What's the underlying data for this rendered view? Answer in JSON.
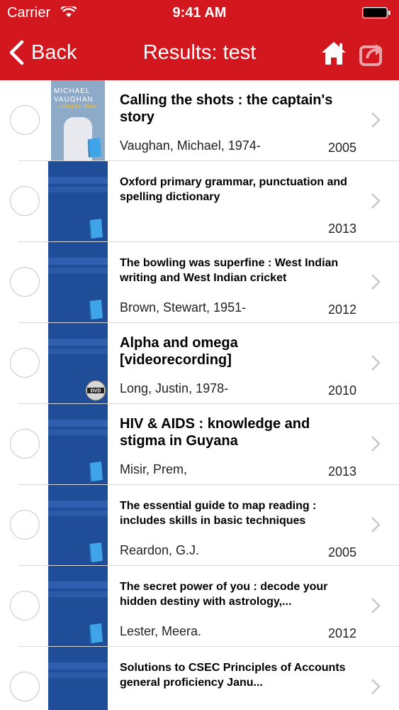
{
  "status_bar": {
    "carrier": "Carrier",
    "time": "9:41 AM"
  },
  "nav": {
    "back_label": "Back",
    "title": "Results: test"
  },
  "results": [
    {
      "title": "Calling the shots : the captain's story",
      "author": "Vaughan, Michael, 1974-",
      "year": "2005",
      "media": "book",
      "cover": {
        "line1": "MICHAEL",
        "line2": "VAUGHAN",
        "line3": "Calling the Shots"
      }
    },
    {
      "title": "Oxford primary grammar, punctuation and spelling dictionary",
      "author": "",
      "year": "2013",
      "media": "book"
    },
    {
      "title": "The bowling was superfine : West Indian writing and West Indian cricket",
      "author": "Brown, Stewart, 1951-",
      "year": "2012",
      "media": "book"
    },
    {
      "title": "Alpha and omega [videorecording]",
      "author": "Long, Justin, 1978-",
      "year": "2010",
      "media": "dvd"
    },
    {
      "title": "HIV & AIDS : knowledge and stigma in Guyana",
      "author": "Misir, Prem,",
      "year": "2013",
      "media": "book"
    },
    {
      "title": "The essential guide to map reading : includes skills in basic techniques",
      "author": "Reardon, G.J.",
      "year": "2005",
      "media": "book"
    },
    {
      "title": "The secret power of you : decode your hidden destiny with astrology,...",
      "author": "Lester, Meera.",
      "year": "2012",
      "media": "book"
    },
    {
      "title": "Solutions to CSEC Principles of Accounts general proficiency Janu...",
      "author": "",
      "year": "",
      "media": "book"
    }
  ],
  "colors": {
    "brand": "#d3171f",
    "thumb": "#1f4d98"
  }
}
